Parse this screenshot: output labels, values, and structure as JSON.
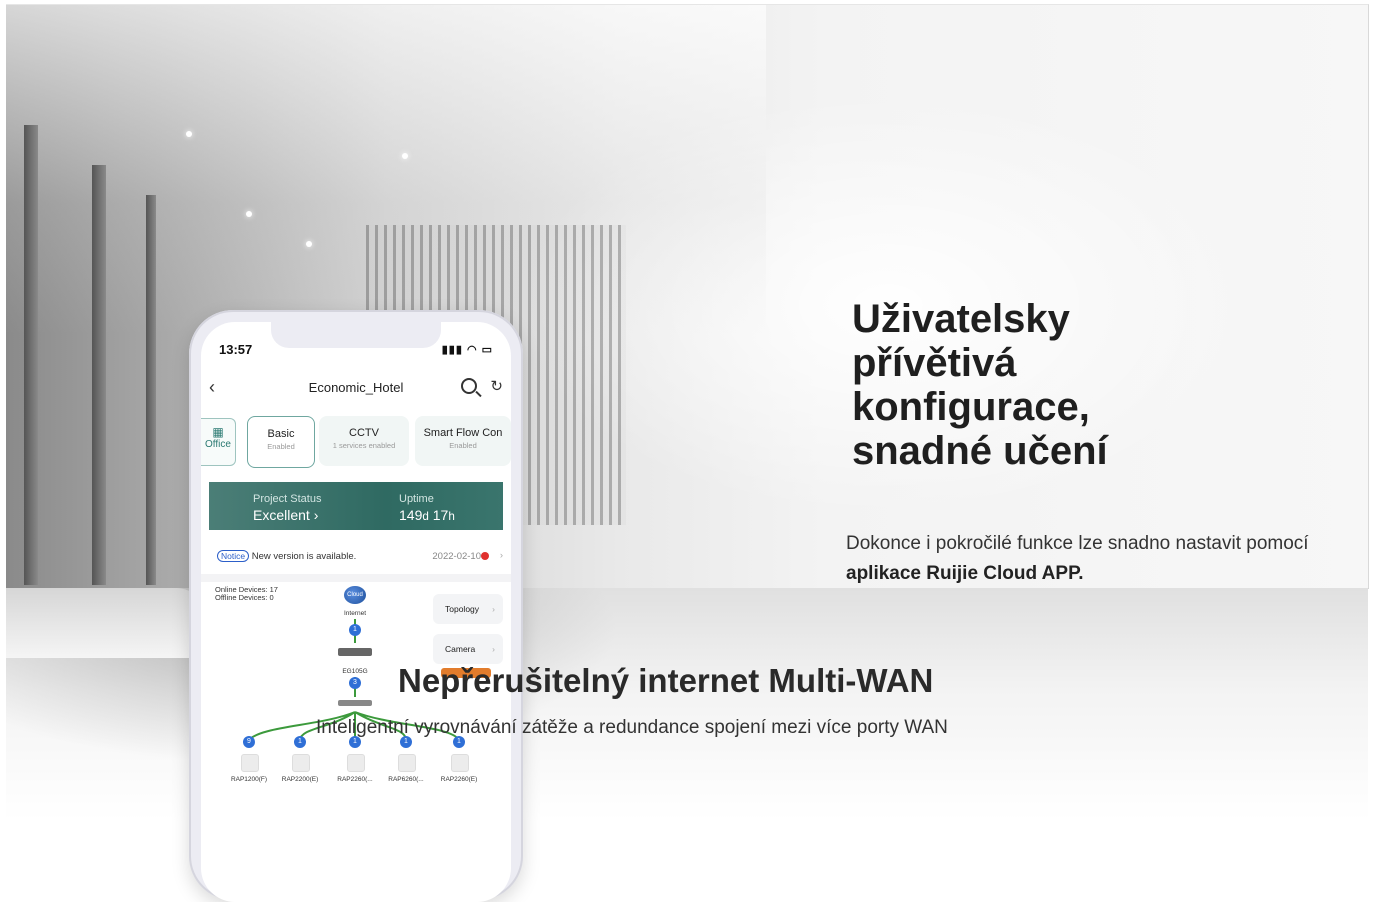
{
  "hero": {
    "headline": "Uživatelsky přívětivá konfigurace, snadné učení",
    "sub_pre": "Dokonce i pokročilé funkce lze snadno nastavit pomocí ",
    "sub_bold": "aplikace Ruijie Cloud APP."
  },
  "section2": {
    "title": "Nepřerušitelný internet Multi-WAN",
    "subtitle": "Inteligentní vyrovnávání zátěže a redundance spojení mezi více porty WAN"
  },
  "phone": {
    "time": "13:57",
    "project_name": "Economic_Hotel",
    "office_label": "Office",
    "tabs": [
      {
        "title": "Basic",
        "sub": "Enabled"
      },
      {
        "title": "CCTV",
        "sub": "1 services enabled"
      },
      {
        "title": "Smart Flow Con",
        "sub": "Enabled"
      }
    ],
    "status": {
      "label": "Project Status",
      "value": "Excellent",
      "uptime_label": "Uptime",
      "uptime_days": "149",
      "uptime_d": "d",
      "uptime_hours": "17",
      "uptime_h": "h"
    },
    "notice": {
      "tag": "Notice",
      "text": "New version is available.",
      "date": "2022-02-10"
    },
    "topology": {
      "online": "Online Devices: 17",
      "offline": "Offline Devices: 0",
      "cloud": "Cloud",
      "internet": "Internet",
      "gateway": "EG105G",
      "topology_btn": "Topology",
      "camera_btn": "Camera",
      "badges": [
        "1",
        "3",
        "9",
        "1",
        "1",
        "1",
        "1"
      ],
      "aps": [
        "RAP1200(F)",
        "RAP2200(E)",
        "RAP2260(...",
        "RAP6260(...",
        "RAP2260(E)"
      ]
    }
  },
  "colors": {
    "accent_teal": "#2f6a62",
    "badge_blue": "#2f6fd6",
    "link_green": "#3c9a3c",
    "notice_red": "#e0312e"
  }
}
